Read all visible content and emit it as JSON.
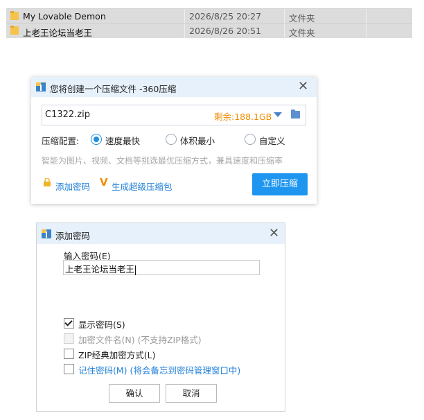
{
  "files": [
    {
      "name": "My Lovable Demon",
      "date": "2026/8/25 20:27",
      "type": "文件夹"
    },
    {
      "name": "上老王论坛当老王",
      "date": "2026/8/26 20:51",
      "type": "文件夹"
    }
  ],
  "compress_dialog": {
    "title": "您将创建一个压缩文件 -360压缩",
    "filename": "C1322.zip",
    "free_space": "剩余:188.1GB",
    "config_label": "压缩配置:",
    "options": [
      "速度最快",
      "体积最小",
      "自定义"
    ],
    "selected_option": "速度最快",
    "hint": "智能为图片、视频、文档等挑选最优压缩方式，兼具速度和压缩率",
    "add_password": "添加密码",
    "super_package": "生成超级压缩包",
    "compress_now": "立即压缩"
  },
  "password_dialog": {
    "title": "添加密码",
    "input_label": "输入密码(E)",
    "password_value": "上老王论坛当老王",
    "checkboxes": [
      {
        "label": "显示密码(S)",
        "checked": true,
        "disabled": false
      },
      {
        "label": "加密文件名(N) (不支持ZIP格式)",
        "checked": false,
        "disabled": true
      },
      {
        "label": "ZIP经典加密方式(L)",
        "checked": false,
        "disabled": false
      },
      {
        "label": "记住密码(M) (将会备忘到密码管理窗口中)",
        "checked": false,
        "disabled": false
      }
    ],
    "ok": "确认",
    "cancel": "取消"
  },
  "colors": {
    "accent": "#1e96f0",
    "warning": "#f08c00",
    "header_bg": "#e7f1fb",
    "folder": "#f5c34a"
  }
}
